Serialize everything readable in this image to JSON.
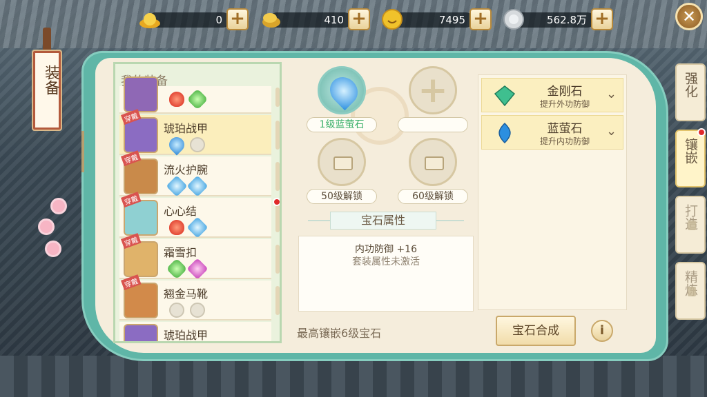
{
  "currencies": [
    {
      "name": "gold-ingot",
      "value": "0",
      "icon": "gold-ingot-icon",
      "color": "#f1c232"
    },
    {
      "name": "gold-coin",
      "value": "410",
      "icon": "gold-coin-icon",
      "color": "#e8b33a"
    },
    {
      "name": "coin",
      "value": "7495",
      "icon": "coin-icon",
      "color": "#f0c22b"
    },
    {
      "name": "silver",
      "value": "562.8万",
      "icon": "silver-coin-icon",
      "color": "#c9cdd2"
    }
  ],
  "title": "装备",
  "equipment": {
    "header": "我的装备",
    "wear_badge": "穿戴",
    "items": [
      {
        "name": "",
        "gems": [
          "red",
          "green"
        ],
        "worn": false
      },
      {
        "name": "琥珀战甲",
        "gems": [
          "blue",
          "empty"
        ],
        "worn": true,
        "selected": true
      },
      {
        "name": "流火护腕",
        "gems": [
          "diamond",
          "diamond"
        ],
        "worn": true
      },
      {
        "name": "心心结",
        "gems": [
          "red",
          "diamond"
        ],
        "worn": true,
        "notify": true
      },
      {
        "name": "霜雪扣",
        "gems": [
          "green",
          "pink"
        ],
        "worn": true
      },
      {
        "name": "翘金马靴",
        "gems": [
          "empty",
          "empty"
        ],
        "worn": true
      },
      {
        "name": "琥珀战甲",
        "gems": [],
        "worn": false
      }
    ]
  },
  "slots": {
    "slot1_label": "1级蓝萤石",
    "slot2_label": "",
    "lock1_label": "50级解锁",
    "lock2_label": "60级解锁"
  },
  "attributes": {
    "title": "宝石属性",
    "line1": "内功防御 +16",
    "line2": "套装属性未激活"
  },
  "max_inlay": "最高镶嵌6级宝石",
  "gem_list": [
    {
      "name": "金刚石",
      "desc": "提升外功防御",
      "icon": "diamond-gem-icon",
      "color": "#3fbf8f"
    },
    {
      "name": "蓝萤石",
      "desc": "提升内功防御",
      "icon": "blue-gem-icon",
      "color": "#2c8fe0"
    }
  ],
  "buttons": {
    "synthesize": "宝石合成",
    "info": "i",
    "close": "✕"
  },
  "tabs": [
    {
      "label": "强化",
      "state": "normal"
    },
    {
      "label": "镶嵌",
      "state": "active"
    },
    {
      "label": "打造",
      "state": "locked"
    },
    {
      "label": "精炼",
      "state": "locked"
    }
  ]
}
